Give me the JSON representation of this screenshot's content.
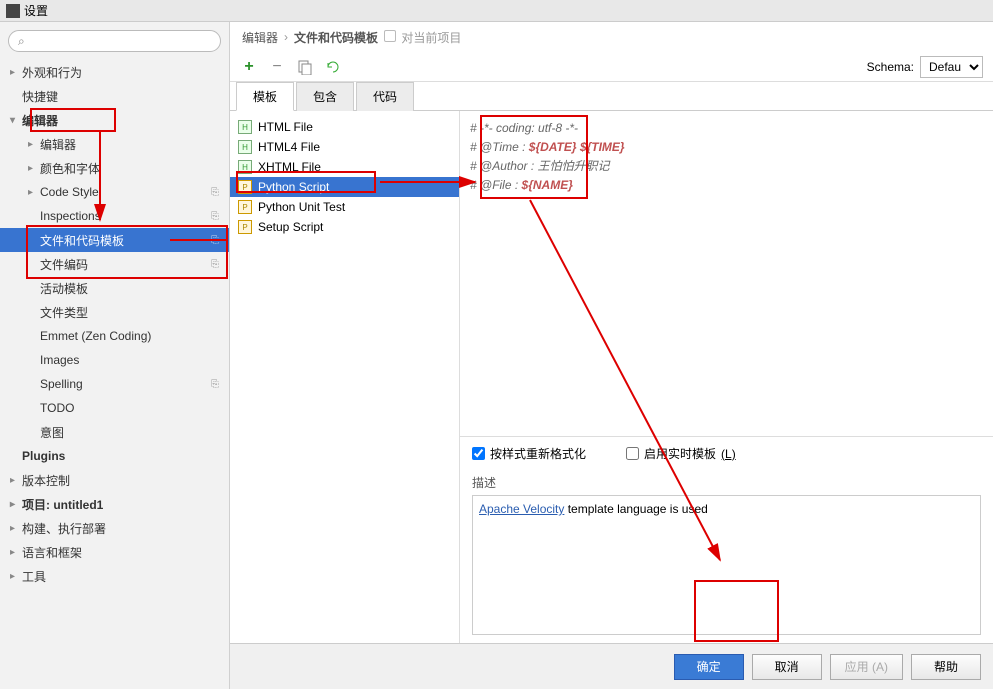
{
  "window": {
    "title": "设置"
  },
  "search": {
    "placeholder": ""
  },
  "sidebar": {
    "items": [
      {
        "label": "外观和行为",
        "arrow": "▸",
        "level": 0
      },
      {
        "label": "快捷键",
        "arrow": "",
        "level": 0
      },
      {
        "label": "编辑器",
        "arrow": "▾",
        "level": 0,
        "bold": true
      },
      {
        "label": "编辑器",
        "arrow": "▸",
        "level": 1
      },
      {
        "label": "颜色和字体",
        "arrow": "▸",
        "level": 1
      },
      {
        "label": "Code Style",
        "arrow": "▸",
        "level": 1,
        "badge": "⎘"
      },
      {
        "label": "Inspections",
        "arrow": "",
        "level": 1,
        "badge": "⎘"
      },
      {
        "label": "文件和代码模板",
        "arrow": "",
        "level": 1,
        "selected": true,
        "badge": "⎘"
      },
      {
        "label": "文件编码",
        "arrow": "",
        "level": 1,
        "badge": "⎘"
      },
      {
        "label": "活动模板",
        "arrow": "",
        "level": 1
      },
      {
        "label": "文件类型",
        "arrow": "",
        "level": 1
      },
      {
        "label": "Emmet (Zen Coding)",
        "arrow": "",
        "level": 1
      },
      {
        "label": "Images",
        "arrow": "",
        "level": 1
      },
      {
        "label": "Spelling",
        "arrow": "",
        "level": 1,
        "badge": "⎘"
      },
      {
        "label": "TODO",
        "arrow": "",
        "level": 1
      },
      {
        "label": "意图",
        "arrow": "",
        "level": 1
      },
      {
        "label": "Plugins",
        "arrow": "",
        "level": 0,
        "bold": true
      },
      {
        "label": "版本控制",
        "arrow": "▸",
        "level": 0
      },
      {
        "label": "项目: untitled1",
        "arrow": "▸",
        "level": 0,
        "bold": true
      },
      {
        "label": "构建、执行部署",
        "arrow": "▸",
        "level": 0
      },
      {
        "label": "语言和框架",
        "arrow": "▸",
        "level": 0
      },
      {
        "label": "工具",
        "arrow": "▸",
        "level": 0
      }
    ]
  },
  "breadcrumb": {
    "a": "编辑器",
    "b": "文件和代码模板",
    "proj": "对当前项目"
  },
  "schema": {
    "label": "Schema:",
    "value": "Defau"
  },
  "tabs": [
    {
      "label": "模板",
      "active": true
    },
    {
      "label": "包含",
      "active": false
    },
    {
      "label": "代码",
      "active": false
    }
  ],
  "files": [
    {
      "label": "HTML File",
      "kind": "h"
    },
    {
      "label": "HTML4 File",
      "kind": "h"
    },
    {
      "label": "XHTML File",
      "kind": "h"
    },
    {
      "label": "Python Script",
      "kind": "py",
      "selected": true
    },
    {
      "label": "Python Unit Test",
      "kind": "py"
    },
    {
      "label": "Setup Script",
      "kind": "py"
    }
  ],
  "code": {
    "l1a": "# -*- coding: utf-8 -*-",
    "l2a": "# @Time : ",
    "l2b": "${DATE} ${TIME}",
    "l3a": "# @Author : ",
    "l3b": "王怕怕升职记",
    "l4a": "# @File : ",
    "l4b": "${NAME}"
  },
  "opts": {
    "reformat": "按样式重新格式化",
    "live": "启用实时模板",
    "live_key": "(L)"
  },
  "desc": {
    "label": "描述",
    "link": "Apache Velocity",
    "rest": " template language is used"
  },
  "footer": {
    "ok": "确定",
    "cancel": "取消",
    "apply": "应用 (A)",
    "help": "帮助"
  }
}
